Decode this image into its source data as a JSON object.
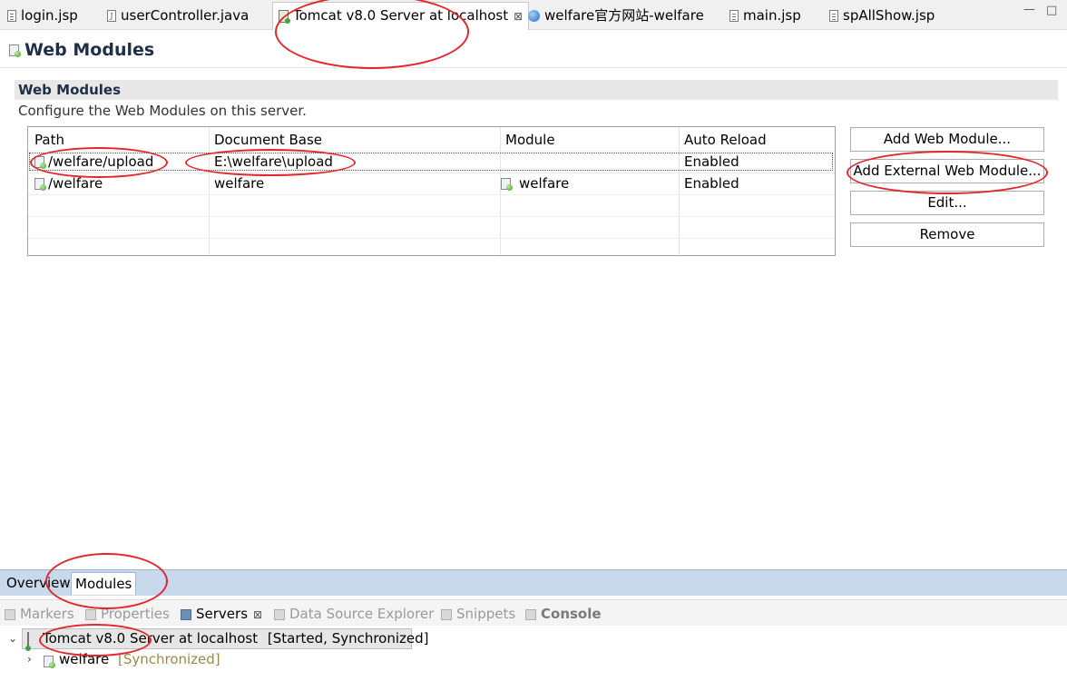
{
  "editor_tabs": [
    {
      "label": "login.jsp",
      "icon": "jsp-file-icon"
    },
    {
      "label": "userController.java",
      "icon": "java-file-icon"
    },
    {
      "label": "Tomcat v8.0 Server at localhost",
      "icon": "server-icon",
      "active": true,
      "close": "⊠"
    },
    {
      "label": "welfare官方网站-welfare",
      "icon": "web-browser-icon"
    },
    {
      "label": "main.jsp",
      "icon": "jsp-file-icon"
    },
    {
      "label": "spAllShow.jsp",
      "icon": "jsp-file-icon"
    }
  ],
  "page": {
    "title": "Web Modules",
    "section_title": "Web Modules",
    "section_description": "Configure the Web Modules on this server."
  },
  "table": {
    "columns": [
      "Path",
      "Document Base",
      "Module",
      "Auto Reload"
    ],
    "rows": [
      {
        "path": "/welfare/upload",
        "document_base": "E:\\welfare\\upload",
        "module": "",
        "auto_reload": "Enabled",
        "selected": true
      },
      {
        "path": "/welfare",
        "document_base": "welfare",
        "module": "welfare",
        "auto_reload": "Enabled"
      }
    ]
  },
  "buttons": {
    "add_web_module": "Add Web Module...",
    "add_external_web_module": "Add External Web Module...",
    "edit": "Edit...",
    "remove": "Remove"
  },
  "page_tabs": [
    {
      "label": "Overview"
    },
    {
      "label": "Modules",
      "active": true
    }
  ],
  "view_tabs": [
    {
      "label": "Markers"
    },
    {
      "label": "Properties"
    },
    {
      "label": "Servers",
      "active": true,
      "close": "⊠"
    },
    {
      "label": "Data Source Explorer"
    },
    {
      "label": "Snippets"
    },
    {
      "label": "Console"
    }
  ],
  "servers_tree": {
    "server_label": "Tomcat v8.0 Server at localhost",
    "server_status": "[Started, Synchronized]",
    "module_label": "welfare",
    "module_status": "[Synchronized]"
  },
  "colors": {
    "annotation": "#e3262b",
    "title_text": "#1f2f45",
    "page_tab_bar": "#c8d9ec"
  }
}
